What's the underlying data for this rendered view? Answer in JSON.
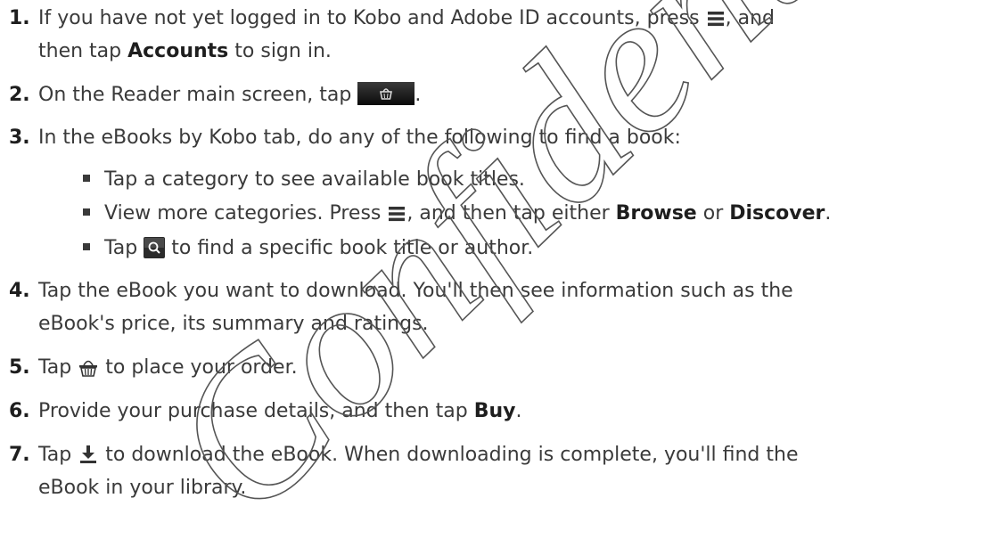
{
  "steps": [
    {
      "num": "1.",
      "a": "If you have not yet logged in to Kobo and Adobe ID accounts, press ",
      "icon": "menu-icon",
      "b": ", and",
      "line2a": "then tap ",
      "bold": "Accounts",
      "line2b": " to sign in."
    },
    {
      "num": "2.",
      "a": "On the Reader main screen, tap ",
      "icon": "shop-icon",
      "b": "."
    },
    {
      "num": "3.",
      "a": "In the eBooks by Kobo tab, do any of the following to find a book:"
    },
    {
      "num": "4.",
      "a": "Tap the eBook you want to download. You'll then see information such as the",
      "line2": "eBook's price, its summary and ratings."
    },
    {
      "num": "5.",
      "a": "Tap ",
      "icon": "basket-icon",
      "b": " to place your order."
    },
    {
      "num": "6.",
      "a": "Provide your purchase details, and then tap ",
      "bold": "Buy",
      "b": "."
    },
    {
      "num": "7.",
      "a": "Tap ",
      "icon": "download-icon",
      "b": " to download the eBook. When downloading is complete, you'll find the",
      "line2": "eBook in your library."
    }
  ],
  "bullets": [
    {
      "a": "Tap a category to see available book titles."
    },
    {
      "a": "View more categories. Press ",
      "icon": "menu-icon",
      "b": ", and then tap either ",
      "bold1": "Browse",
      "c": " or ",
      "bold2": "Discover",
      "d": "."
    },
    {
      "a": "Tap ",
      "icon": "search-icon",
      "b": " to find a specific book title or author."
    }
  ],
  "watermark": "Confidential"
}
